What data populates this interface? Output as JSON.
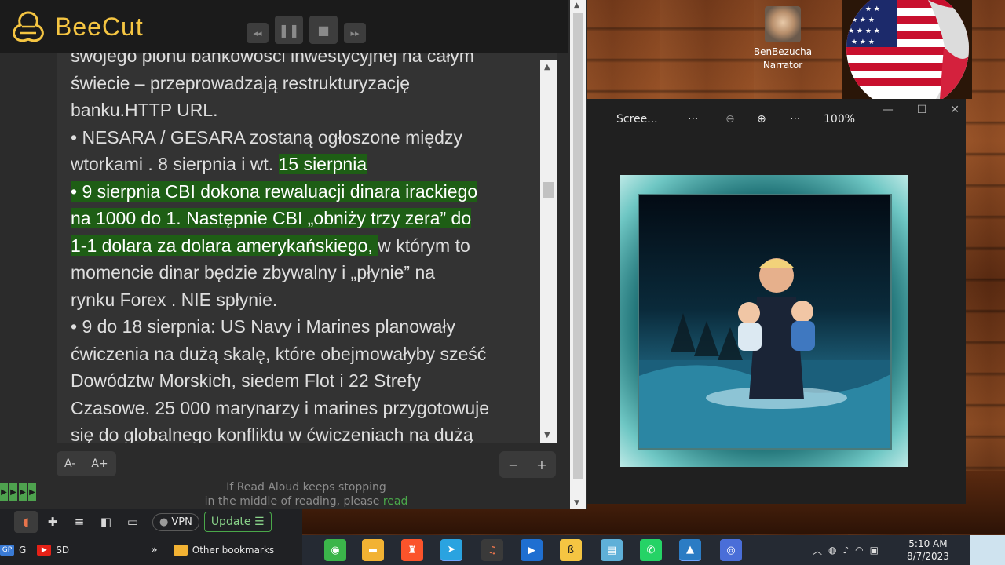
{
  "app": {
    "brand": "BeeCut",
    "colors": {
      "brand": "#f5c542",
      "highlight": "#1e5e15",
      "accent_green": "#4aa84a"
    }
  },
  "transport": [
    {
      "icon": "rewind-icon",
      "glyph": "◂◂"
    },
    {
      "icon": "pause-icon",
      "glyph": "❚❚"
    },
    {
      "icon": "stop-icon",
      "glyph": "■"
    },
    {
      "icon": "fast-forward-icon",
      "glyph": "▸▸"
    }
  ],
  "reader": {
    "lines": [
      {
        "text": "swojego pionu bankowości inwestycyjnej na całym",
        "hl": ""
      },
      {
        "text": "świecie – przeprowadzają restrukturyzację",
        "hl": ""
      },
      {
        "text": "banku.HTTP URL.",
        "hl": ""
      },
      {
        "text": "• NESARA / GESARA zostaną ogłoszone między",
        "hl": ""
      },
      {
        "text": "wtorkami . 8 sierpnia i wt. ",
        "hl": "15 sierpnia"
      },
      {
        "text": "",
        "hl": "• 9 sierpnia CBI dokona rewaluacji dinara irackiego"
      },
      {
        "text": "",
        "hl": "na 1000 do 1. Następnie CBI „obniży trzy zera” do"
      },
      {
        "text": "w którym to",
        "hl": "1-1 dolara za dolara amerykańskiego, ",
        "hl_first": true
      },
      {
        "text": "momencie dinar będzie zbywalny i „płynie” na",
        "hl": ""
      },
      {
        "text": "rynku Forex . NIE spłynie.",
        "hl": ""
      },
      {
        "text": "• 9 do 18 sierpnia: US Navy i Marines planowały",
        "hl": ""
      },
      {
        "text": "ćwiczenia na dużą skalę, które obejmowałyby sześć",
        "hl": ""
      },
      {
        "text": "Dowództw Morskich, siedem Flot i 22 Strefy",
        "hl": ""
      },
      {
        "text": "Czasowe. 25 000 marynarzy i marines przygotowuje",
        "hl": ""
      },
      {
        "text": "się do globalnego konfliktu w ćwiczeniach na dużą",
        "hl": ""
      }
    ],
    "font_smaller": "A-",
    "font_larger": "A+",
    "zoom_out": "−",
    "zoom_in": "+",
    "note_line1": "If Read Aloud keeps stopping",
    "note_line2": "in the middle of reading, please ",
    "note_link": "read"
  },
  "desktop": {
    "narrator_label_1": "BenBezucha",
    "narrator_label_2": "Narrator"
  },
  "photos": {
    "title": "Scree...",
    "more": "···",
    "zoom_out_icon": "zoom-out-icon",
    "zoom_in_icon": "zoom-in-icon",
    "zoom": "100%",
    "minimize": "—",
    "maximize": "☐",
    "close": "✕"
  },
  "browser": {
    "vpn": "VPN",
    "update": "Update",
    "bookmarks": [
      {
        "label": "G",
        "icon": "GP"
      },
      {
        "label": "SD",
        "icon": "▶"
      }
    ],
    "more_bookmarks": "»",
    "other_bookmarks": "Other bookmarks"
  },
  "taskbar": {
    "time": "5:10 AM",
    "date": "8/7/2023"
  }
}
